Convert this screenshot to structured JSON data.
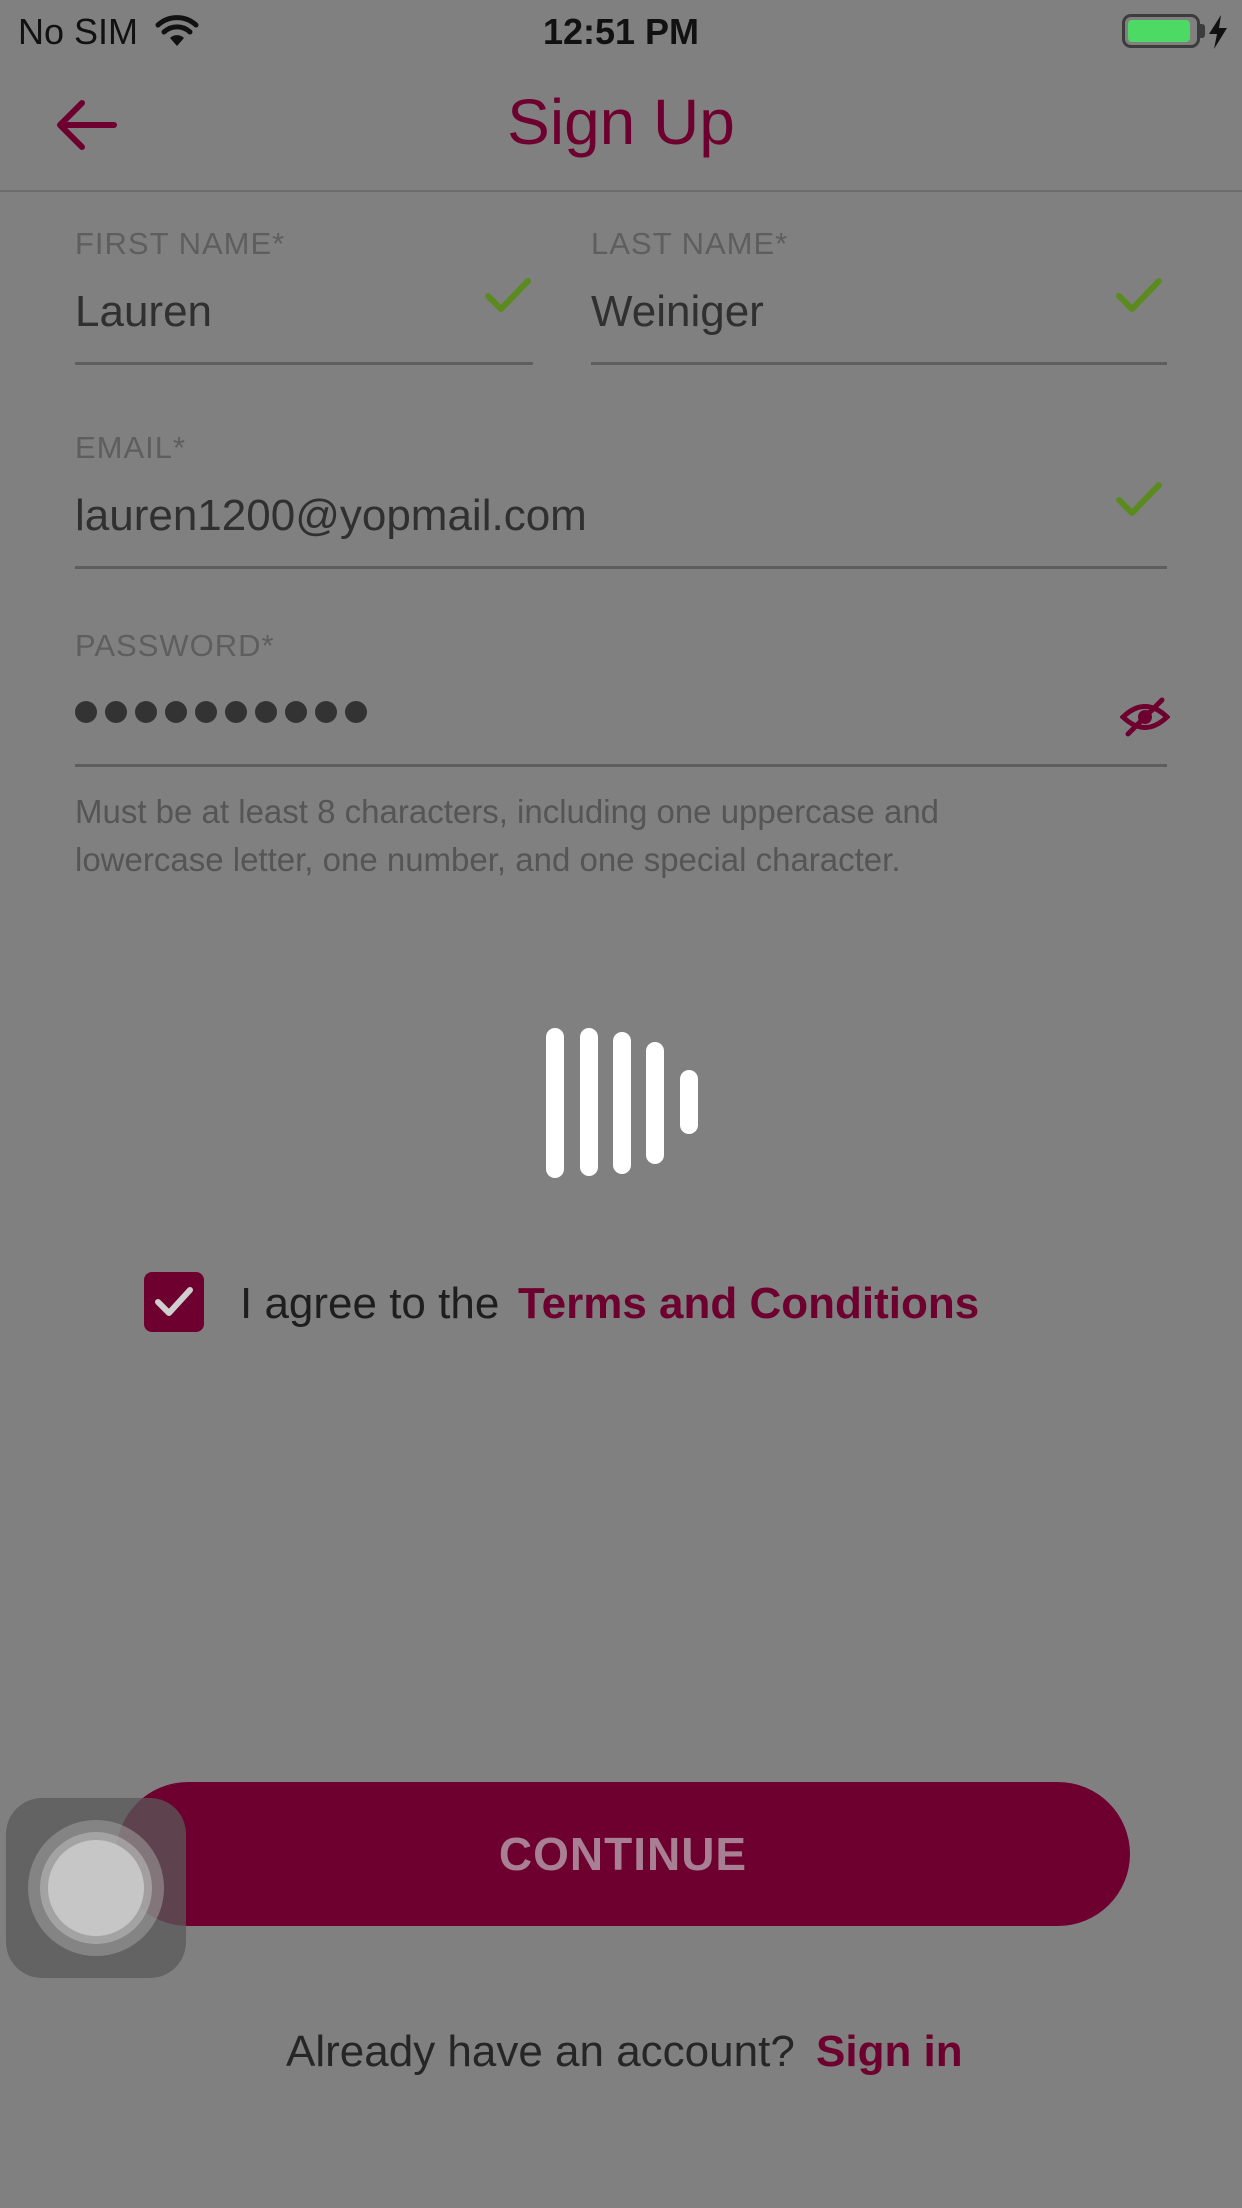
{
  "status_bar": {
    "carrier": "No SIM",
    "time": "12:51 PM",
    "battery_color": "#4cd964"
  },
  "nav": {
    "title": "Sign Up",
    "back_icon": "arrow-left-icon"
  },
  "form": {
    "first_name": {
      "label": "FIRST NAME*",
      "value": "Lauren",
      "valid": true
    },
    "last_name": {
      "label": "LAST NAME*",
      "value": "Weiniger",
      "valid": true
    },
    "email": {
      "label": "EMAIL*",
      "value": "lauren1200@yopmail.com",
      "valid": true
    },
    "password": {
      "label": "PASSWORD*",
      "masked_length": 10,
      "toggle_icon": "eye-slash-icon"
    },
    "password_hint": "Must be at least 8 characters, including one uppercase and lowercase letter, one number, and one special character."
  },
  "terms": {
    "checked": true,
    "prefix": "I agree to the",
    "link": "Terms and Conditions"
  },
  "continue_label": "CONTINUE",
  "footer": {
    "question": "Already have an account?",
    "link": "Sign in"
  },
  "colors": {
    "accent": "#6e0030",
    "valid_check": "#5b8a1e",
    "overlay": "#808080"
  },
  "loading": true
}
